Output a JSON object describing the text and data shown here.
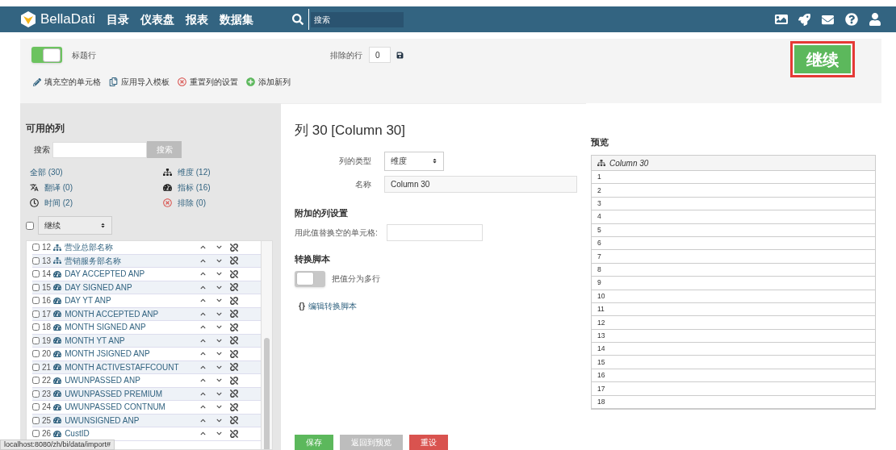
{
  "navbar": {
    "brand": "BellaDati",
    "menu": [
      "目录",
      "仪表盘",
      "报表",
      "数据集"
    ],
    "search": {
      "placeholder": "搜索"
    }
  },
  "toolbar": {
    "header_row": {
      "label": "标题行",
      "on": true
    },
    "excluded_rows": {
      "label": "排除的行",
      "value": "0"
    },
    "actions": [
      {
        "kind": "fill",
        "label": "填充空的单元格"
      },
      {
        "kind": "template",
        "label": "应用导入模板"
      },
      {
        "kind": "reset",
        "label": "重置列的设置"
      },
      {
        "kind": "add",
        "label": "添加新列"
      }
    ],
    "continue_button": "继续"
  },
  "sidebar": {
    "title": "可用的列",
    "search_label": "搜索",
    "search_button": "搜索",
    "filters": [
      {
        "kind": "all",
        "label": "全部 (30)"
      },
      {
        "kind": "dimension",
        "label": "维度 (12)"
      },
      {
        "kind": "translation",
        "label": "翻译 (0)"
      },
      {
        "kind": "indicator",
        "label": "指标 (16)"
      },
      {
        "kind": "time",
        "label": "时间 (2)"
      },
      {
        "kind": "excluded",
        "label": "排除 (0)"
      }
    ],
    "bulk": {
      "checked": false,
      "action": "继续"
    },
    "columns": [
      {
        "number": "12",
        "kind": "dimension",
        "name": "营业总部名称",
        "checked": false
      },
      {
        "number": "13",
        "kind": "dimension",
        "name": "营销服务部名称",
        "checked": false
      },
      {
        "number": "14",
        "kind": "indicator",
        "name": "DAY ACCEPTED ANP",
        "checked": false
      },
      {
        "number": "15",
        "kind": "indicator",
        "name": "DAY SIGNED ANP",
        "checked": false
      },
      {
        "number": "16",
        "kind": "indicator",
        "name": "DAY YT ANP",
        "checked": false
      },
      {
        "number": "17",
        "kind": "indicator",
        "name": "MONTH ACCEPTED ANP",
        "checked": false
      },
      {
        "number": "18",
        "kind": "indicator",
        "name": "MONTH SIGNED ANP",
        "checked": false
      },
      {
        "number": "19",
        "kind": "indicator",
        "name": "MONTH YT ANP",
        "checked": false
      },
      {
        "number": "20",
        "kind": "indicator",
        "name": "MONTH JSIGNED ANP",
        "checked": false
      },
      {
        "number": "21",
        "kind": "indicator",
        "name": "MONTH ACTIVESTAFFCOUNT",
        "checked": false
      },
      {
        "number": "22",
        "kind": "indicator",
        "name": "UWUNPASSED ANP",
        "checked": false
      },
      {
        "number": "23",
        "kind": "indicator",
        "name": "UWUNPASSED PREMIUM",
        "checked": false
      },
      {
        "number": "24",
        "kind": "indicator",
        "name": "UWUNPASSED CONTNUM",
        "checked": false
      },
      {
        "number": "25",
        "kind": "indicator",
        "name": "UWUNSIGNED ANP",
        "checked": false
      },
      {
        "number": "26",
        "kind": "indicator",
        "name": "CustID",
        "checked": false
      }
    ]
  },
  "editor": {
    "title": "列 30 [Column 30]",
    "type_label": "列的类型",
    "type_value": "维度",
    "name_label": "名称",
    "name_value": "Column 30",
    "extra_section": "附加的列设置",
    "replace_label": "用此值替换空的单元格:",
    "script_section": "转换脚本",
    "split": {
      "label": "把值分为多行",
      "on": false
    },
    "edit_script": {
      "icon": "{}",
      "label": "编辑转换脚本"
    },
    "buttons": [
      {
        "kind": "save",
        "label": "保存"
      },
      {
        "kind": "back",
        "label": "返回到预览"
      },
      {
        "kind": "reset",
        "label": "重设"
      }
    ]
  },
  "preview": {
    "title": "预览",
    "column": "Column 30",
    "rows": [
      "1",
      "2",
      "3",
      "4",
      "5",
      "6",
      "7",
      "8",
      "9",
      "10",
      "11",
      "12",
      "13",
      "14",
      "15",
      "16",
      "17",
      "18"
    ]
  },
  "status_bar": "localhost:8080/zh/bi/data/import#"
}
